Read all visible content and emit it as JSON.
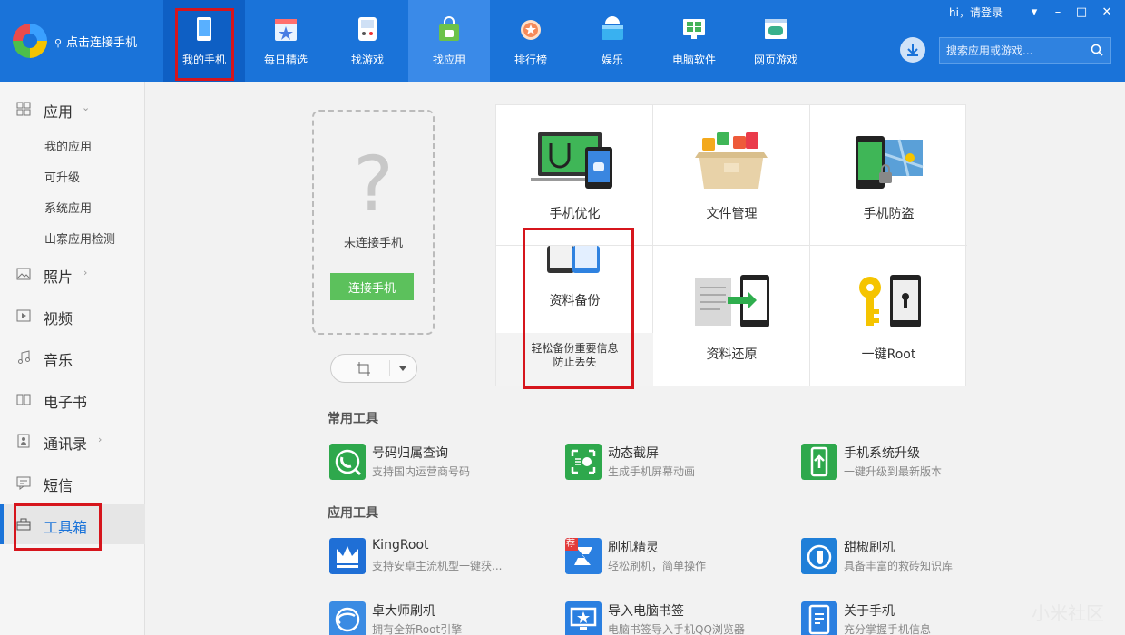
{
  "header": {
    "connect_label": "点击连接手机",
    "login": "hi，请登录",
    "search_placeholder": "搜索应用或游戏...",
    "nav": [
      {
        "label": "我的手机"
      },
      {
        "label": "每日精选"
      },
      {
        "label": "找游戏"
      },
      {
        "label": "找应用"
      },
      {
        "label": "排行榜"
      },
      {
        "label": "娱乐"
      },
      {
        "label": "电脑软件"
      },
      {
        "label": "网页游戏"
      }
    ]
  },
  "sidebar": {
    "apps": "应用",
    "sub": [
      "我的应用",
      "可升级",
      "系统应用",
      "山寨应用检测"
    ],
    "photos": "照片",
    "video": "视频",
    "music": "音乐",
    "ebook": "电子书",
    "contacts": "通讯录",
    "sms": "短信",
    "toolbox": "工具箱"
  },
  "phone": {
    "question": "?",
    "not_connected": "未连接手机",
    "connect_button": "连接手机"
  },
  "grid": {
    "optimize": "手机优化",
    "files": "文件管理",
    "antitheft": "手机防盗",
    "backup": "资料备份",
    "backup_tip_1": "轻松备份重要信息",
    "backup_tip_2": "防止丢失",
    "restore": "资料还原",
    "root": "一键Root"
  },
  "common_tools": {
    "title": "常用工具",
    "items": [
      {
        "name": "号码归属查询",
        "desc": "支持国内运营商号码"
      },
      {
        "name": "动态截屏",
        "desc": "生成手机屏幕动画"
      },
      {
        "name": "手机系统升级",
        "desc": "一键升级到最新版本"
      }
    ]
  },
  "app_tools": {
    "title": "应用工具",
    "items": [
      {
        "name": "KingRoot",
        "desc": "支持安卓主流机型一键获..."
      },
      {
        "name": "刷机精灵",
        "desc": "轻松刷机，简单操作"
      },
      {
        "name": "甜椒刷机",
        "desc": "具备丰富的救砖知识库"
      },
      {
        "name": "卓大师刷机",
        "desc": "拥有全新Root引擎"
      },
      {
        "name": "导入电脑书签",
        "desc": "电脑书签导入手机QQ浏览器"
      },
      {
        "name": "关于手机",
        "desc": "充分掌握手机信息"
      }
    ]
  },
  "badge_text": "荐",
  "watermark": "小米社区",
  "colors": {
    "header": "#1a73d9",
    "accent_green": "#5cc15c",
    "highlight": "#d6151c"
  }
}
